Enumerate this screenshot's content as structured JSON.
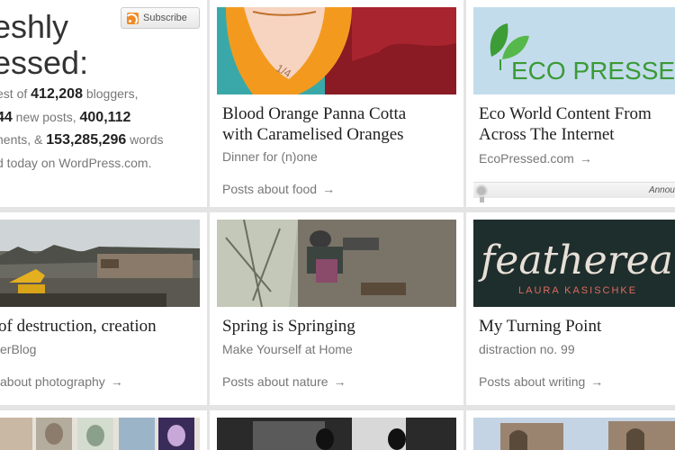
{
  "intro": {
    "heading_line1": "eshly",
    "heading_line2": "essed:",
    "subscribe_label": "Subscribe",
    "line1_prefix": "est of ",
    "bloggers_count": "412,208",
    "line1_suffix": " bloggers,",
    "posts_count": "44",
    "line2_mid": " new posts, ",
    "comments_count": "400,112",
    "line3_prefix": "nents, & ",
    "words_count": "153,285,296",
    "line3_suffix": " words",
    "line4": "d today on WordPress.com."
  },
  "cards": [
    {
      "title": "Blood Orange Panna Cotta with Caramelised Oranges",
      "blog": "Dinner for (n)one",
      "tag": "Posts about food",
      "arrow": "→"
    },
    {
      "title": "Eco World Content From Across The Internet",
      "blog": "EcoPressed.com",
      "blog_arrow": "→",
      "logo_text": "ECO PRESSE",
      "announce": "Announce"
    },
    {
      "title": "of destruction, creation",
      "blog": "erBlog",
      "tag": "about photography",
      "arrow": "→"
    },
    {
      "title": "Spring is Springing",
      "blog": "Make Yourself at Home",
      "tag": "Posts about nature",
      "arrow": "→"
    },
    {
      "title": "My Turning Point",
      "blog": "distraction no. 99",
      "tag": "Posts about writing",
      "arrow": "→",
      "image_text": "featherea",
      "image_subtext": "LAURA KASISCHKE"
    }
  ]
}
